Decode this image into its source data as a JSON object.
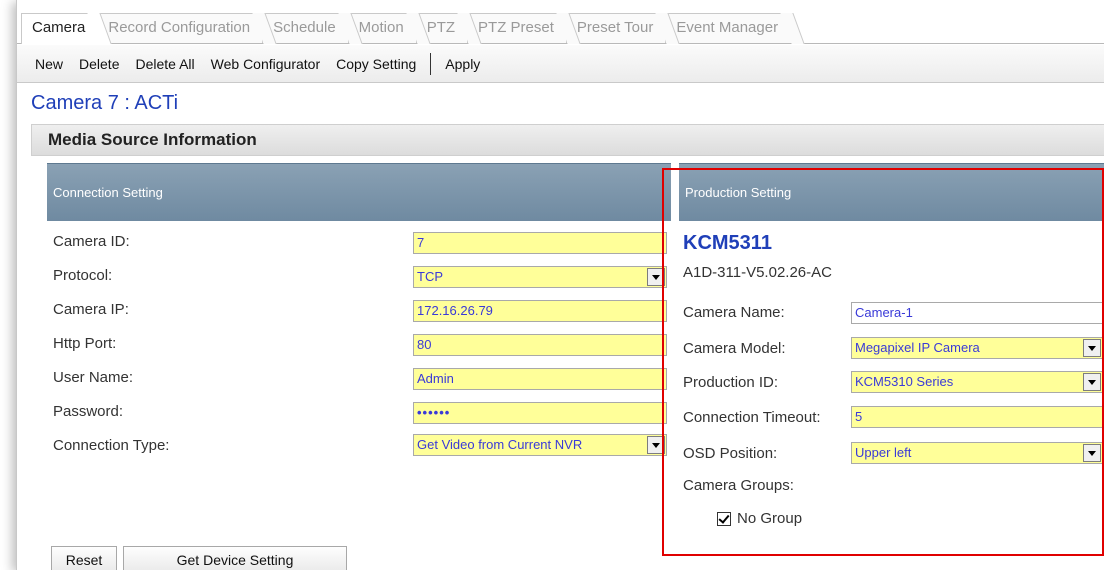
{
  "tabs": [
    {
      "label": "Camera",
      "active": true
    },
    {
      "label": "Record Configuration",
      "active": false
    },
    {
      "label": "Schedule",
      "active": false
    },
    {
      "label": "Motion",
      "active": false
    },
    {
      "label": "PTZ",
      "active": false
    },
    {
      "label": "PTZ Preset",
      "active": false
    },
    {
      "label": "Preset Tour",
      "active": false
    },
    {
      "label": "Event Manager",
      "active": false
    }
  ],
  "toolbar": {
    "new_label": "New",
    "delete_label": "Delete",
    "delete_all_label": "Delete All",
    "web_configurator_label": "Web Configurator",
    "copy_setting_label": "Copy Setting",
    "apply_label": "Apply"
  },
  "camera_title": "Camera 7 : ACTi",
  "section_title": "Media Source Information",
  "connection": {
    "header": "Connection Setting",
    "camera_id_label": "Camera ID:",
    "camera_id": "7",
    "protocol_label": "Protocol:",
    "protocol": "TCP",
    "camera_ip_label": "Camera IP:",
    "camera_ip": "172.16.26.79",
    "http_port_label": "Http Port:",
    "http_port": "80",
    "user_name_label": "User Name:",
    "user_name": "Admin",
    "password_label": "Password:",
    "password_mask": "••••••",
    "connection_type_label": "Connection Type:",
    "connection_type": "Get Video from Current NVR"
  },
  "production": {
    "header": "Production Setting",
    "model": "KCM5311",
    "firmware": "A1D-311-V5.02.26-AC",
    "camera_name_label": "Camera Name:",
    "camera_name": "Camera-1",
    "camera_model_label": "Camera Model:",
    "camera_model": "Megapixel IP Camera",
    "production_id_label": "Production ID:",
    "production_id": "KCM5310 Series",
    "connection_timeout_label": "Connection Timeout:",
    "connection_timeout": "5",
    "osd_position_label": "OSD Position:",
    "osd_position": "Upper left",
    "camera_groups_label": "Camera Groups:",
    "no_group_label": "No Group",
    "no_group_checked": true
  },
  "buttons": {
    "reset_label": "Reset",
    "get_device_setting_label": "Get Device Setting"
  },
  "colors": {
    "field_bg": "#ffff99",
    "header_bg": "#7a93a8",
    "highlight_border": "#e00000",
    "title_blue": "#1f3fb8"
  }
}
